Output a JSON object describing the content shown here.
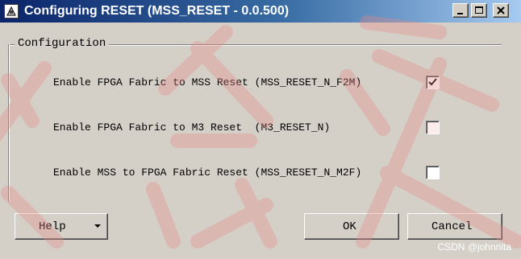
{
  "window": {
    "title": "Configuring RESET (MSS_RESET - 0.0.500)",
    "app_icon": "configure-app-icon",
    "controls": {
      "minimize_icon": "minimize-icon",
      "maximize_icon": "maximize-icon",
      "close_icon": "close-icon"
    }
  },
  "configuration": {
    "group_title": "Configuration",
    "rows": [
      {
        "label": "Enable FPGA Fabric to MSS Reset (MSS_RESET_N_F2M)",
        "checked": true
      },
      {
        "label": "Enable FPGA Fabric to M3 Reset  (M3_RESET_N)",
        "checked": false
      },
      {
        "label": "Enable MSS to FPGA Fabric Reset (MSS_RESET_N_M2F)",
        "checked": false
      }
    ]
  },
  "buttons": {
    "help_label": "Help",
    "help_icon": "dropdown-arrow-icon",
    "ok_label": "OK",
    "cancel_label": "Cancel"
  },
  "watermark": {
    "text": "CSDN @johnnita"
  },
  "colors": {
    "dialog_background": "#d4d0c8",
    "titlebar_start": "#0a246a",
    "titlebar_end": "#a6caf0",
    "overlay_red": "#e88a8a"
  }
}
